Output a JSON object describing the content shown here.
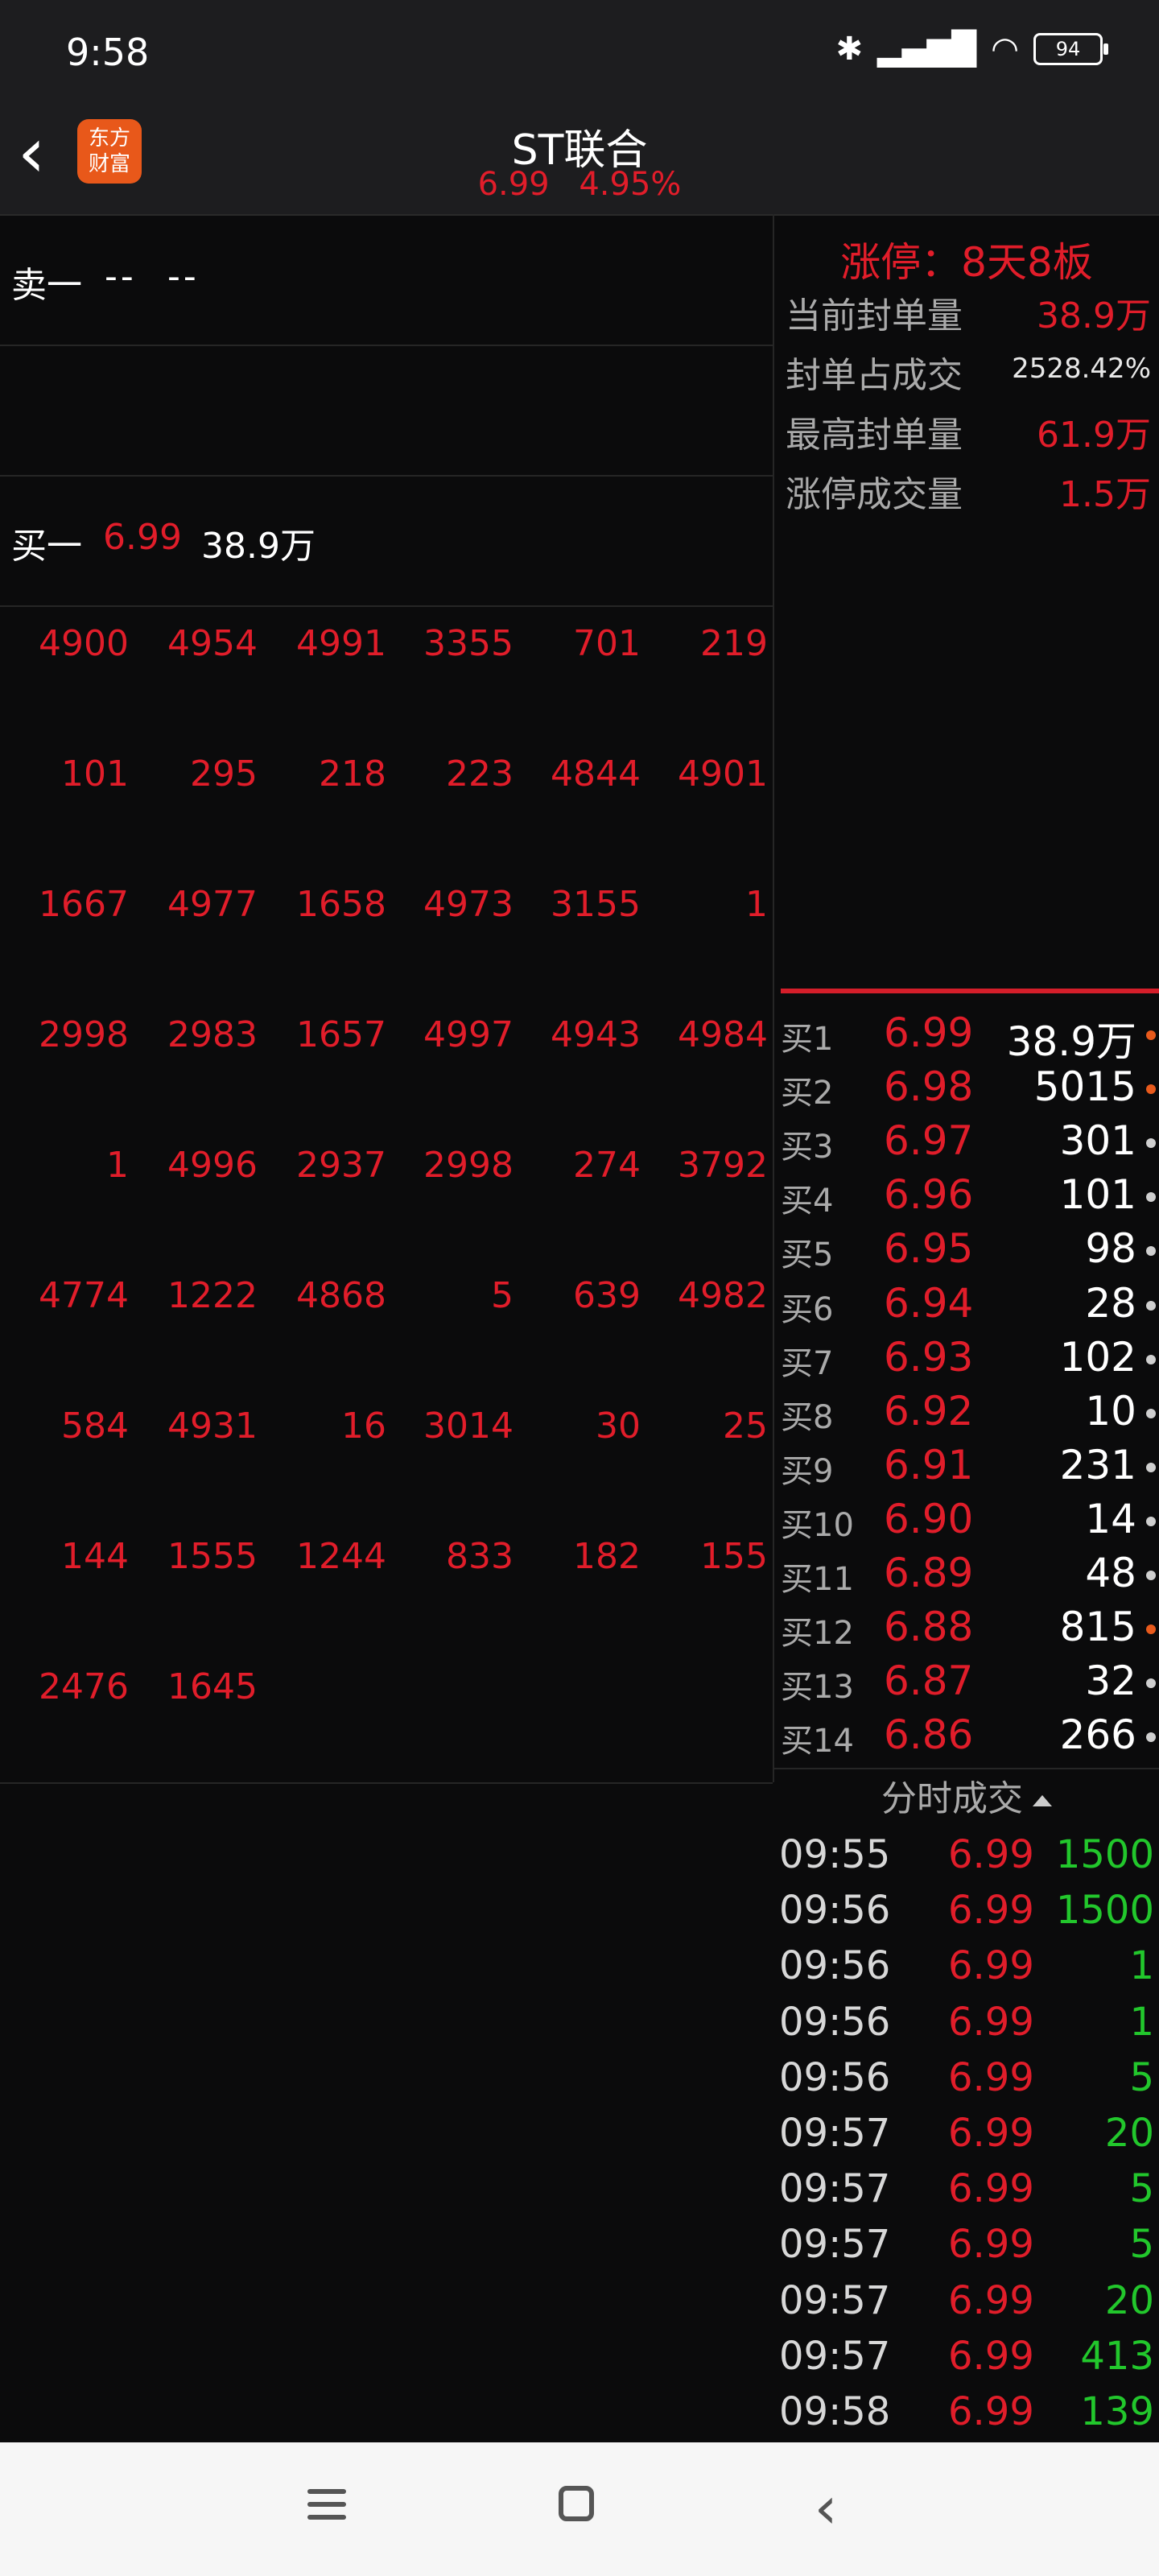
{
  "status_bar": {
    "time": "9:58",
    "battery": "94"
  },
  "header": {
    "logo_text_line1": "东方",
    "logo_text_line2": "财富",
    "title": "ST联合",
    "price": "6.99",
    "change_pct": "4.95%"
  },
  "order_book": {
    "sell1": {
      "label": "卖一",
      "price": "--",
      "volume": "--"
    },
    "buy1": {
      "label": "买一",
      "price": "6.99",
      "volume": "38.9万"
    }
  },
  "queue_orders": [
    [
      "4900",
      "4954",
      "4991",
      "3355",
      "701",
      "219"
    ],
    [
      "101",
      "295",
      "218",
      "223",
      "4844",
      "4901"
    ],
    [
      "1667",
      "4977",
      "1658",
      "4973",
      "3155",
      "1"
    ],
    [
      "2998",
      "2983",
      "1657",
      "4997",
      "4943",
      "4984"
    ],
    [
      "1",
      "4996",
      "2937",
      "2998",
      "274",
      "3792"
    ],
    [
      "4774",
      "1222",
      "4868",
      "5",
      "639",
      "4982"
    ],
    [
      "584",
      "4931",
      "16",
      "3014",
      "30",
      "25"
    ],
    [
      "144",
      "1555",
      "1244",
      "833",
      "182",
      "155"
    ],
    [
      "2476",
      "1645"
    ]
  ],
  "limit_up": {
    "title": "涨停：8天8板",
    "stats": [
      {
        "label": "当前封单量",
        "value": "38.9万"
      },
      {
        "label": "封单占成交",
        "value": "2528.42%"
      },
      {
        "label": "最高封单量",
        "value": "61.9万"
      },
      {
        "label": "涨停成交量",
        "value": "1.5万"
      }
    ]
  },
  "bids": [
    {
      "label": "买1",
      "price": "6.99",
      "volume": "38.9万",
      "dot": "#e85a1c"
    },
    {
      "label": "买2",
      "price": "6.98",
      "volume": "5015",
      "dot": "#e85a1c"
    },
    {
      "label": "买3",
      "price": "6.97",
      "volume": "301",
      "dot": "#cfcfcf"
    },
    {
      "label": "买4",
      "price": "6.96",
      "volume": "101",
      "dot": "#cfcfcf"
    },
    {
      "label": "买5",
      "price": "6.95",
      "volume": "98",
      "dot": "#cfcfcf"
    },
    {
      "label": "买6",
      "price": "6.94",
      "volume": "28",
      "dot": "#cfcfcf"
    },
    {
      "label": "买7",
      "price": "6.93",
      "volume": "102",
      "dot": "#cfcfcf"
    },
    {
      "label": "买8",
      "price": "6.92",
      "volume": "10",
      "dot": "#cfcfcf"
    },
    {
      "label": "买9",
      "price": "6.91",
      "volume": "231",
      "dot": "#cfcfcf"
    },
    {
      "label": "买10",
      "price": "6.90",
      "volume": "14",
      "dot": "#cfcfcf"
    },
    {
      "label": "买11",
      "price": "6.89",
      "volume": "48",
      "dot": "#cfcfcf"
    },
    {
      "label": "买12",
      "price": "6.88",
      "volume": "815",
      "dot": "#e85a1c"
    },
    {
      "label": "买13",
      "price": "6.87",
      "volume": "32",
      "dot": "#cfcfcf"
    },
    {
      "label": "买14",
      "price": "6.86",
      "volume": "266",
      "dot": "#cfcfcf"
    }
  ],
  "ticks_header": "分时成交",
  "ticks": [
    {
      "time": "09:55",
      "price": "6.99",
      "volume": "1500"
    },
    {
      "time": "09:56",
      "price": "6.99",
      "volume": "1500"
    },
    {
      "time": "09:56",
      "price": "6.99",
      "volume": "1"
    },
    {
      "time": "09:56",
      "price": "6.99",
      "volume": "1"
    },
    {
      "time": "09:56",
      "price": "6.99",
      "volume": "5"
    },
    {
      "time": "09:57",
      "price": "6.99",
      "volume": "20"
    },
    {
      "time": "09:57",
      "price": "6.99",
      "volume": "5"
    },
    {
      "time": "09:57",
      "price": "6.99",
      "volume": "5"
    },
    {
      "time": "09:57",
      "price": "6.99",
      "volume": "20"
    },
    {
      "time": "09:57",
      "price": "6.99",
      "volume": "413"
    },
    {
      "time": "09:58",
      "price": "6.99",
      "volume": "139"
    }
  ],
  "colors": {
    "up": "#e11d2a",
    "trade_volume": "#22c72c",
    "limit_bar": "#d51e2a"
  }
}
